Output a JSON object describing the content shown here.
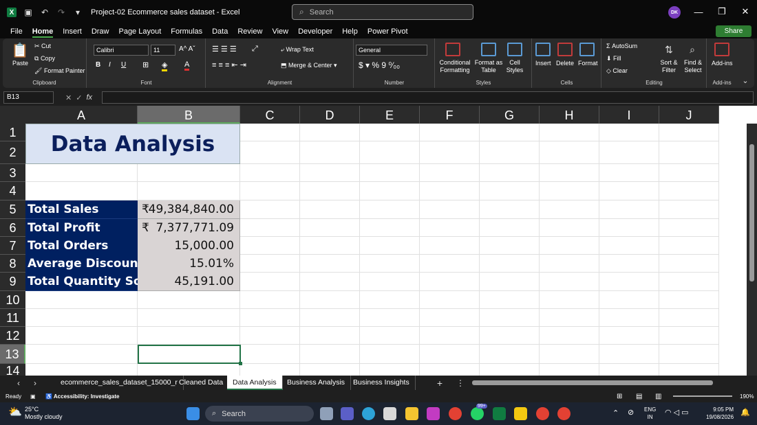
{
  "titlebar": {
    "title": "Project-02 Ecommerce sales dataset - Excel",
    "search_placeholder": "Search",
    "avatar_initials": "DK"
  },
  "menu": [
    "File",
    "Home",
    "Insert",
    "Draw",
    "Page Layout",
    "Formulas",
    "Data",
    "Review",
    "View",
    "Developer",
    "Help",
    "Power Pivot"
  ],
  "share_label": "Share",
  "ribbon": {
    "clipboard": {
      "paste": "Paste",
      "cut": "Cut",
      "copy": "Copy",
      "format_painter": "Format Painter",
      "label": "Clipboard"
    },
    "font": {
      "name": "Calibri",
      "size": "11",
      "label": "Font"
    },
    "alignment": {
      "wrap": "Wrap Text",
      "merge": "Merge & Center",
      "label": "Alignment"
    },
    "number": {
      "format": "General",
      "label": "Number"
    },
    "styles": {
      "conditional": "Conditional Formatting",
      "format_table": "Format as Table",
      "cell_styles": "Cell Styles",
      "label": "Styles"
    },
    "cells": {
      "insert": "Insert",
      "delete": "Delete",
      "format": "Format",
      "label": "Cells"
    },
    "editing": {
      "autosum": "AutoSum",
      "fill": "Fill",
      "clear": "Clear",
      "sort": "Sort & Filter",
      "find": "Find & Select",
      "label": "Editing"
    },
    "addins": {
      "addins": "Add-ins",
      "label": "Add-ins"
    }
  },
  "name_box": "B13",
  "columns": [
    "A",
    "B",
    "C",
    "D",
    "E",
    "F",
    "G",
    "H",
    "I",
    "J"
  ],
  "rows": [
    "1",
    "2",
    "3",
    "4",
    "5",
    "6",
    "7",
    "8",
    "9",
    "10",
    "11",
    "12",
    "13",
    "14"
  ],
  "sheet": {
    "title": "Data Analysis",
    "metrics": [
      {
        "label": "Total Sales",
        "prefix": "₹",
        "value": "49,384,840.00"
      },
      {
        "label": "Total Profit",
        "prefix": "₹",
        "value": "7,377,771.09"
      },
      {
        "label": "Total Orders",
        "prefix": "",
        "value": "15,000.00"
      },
      {
        "label": "Average Discount",
        "prefix": "",
        "value": "15.01%"
      },
      {
        "label": "Total Quantity Sold",
        "prefix": "",
        "value": "45,191.00"
      }
    ]
  },
  "tabs": [
    "ecommerce_sales_dataset_15000_r",
    "Cleaned Data",
    "Data Analysis",
    "Business Analysis",
    "Business Insights"
  ],
  "active_tab": "Data Analysis",
  "status": {
    "ready": "Ready",
    "accessibility": "Accessibility: Investigate",
    "zoom": "190%"
  },
  "taskbar": {
    "temp": "25°C",
    "weather": "Mostly cloudy",
    "search": "Search",
    "lang1": "ENG",
    "lang2": "IN",
    "time": "9:05 PM",
    "date": "19/08/2026",
    "badge": "99+"
  }
}
